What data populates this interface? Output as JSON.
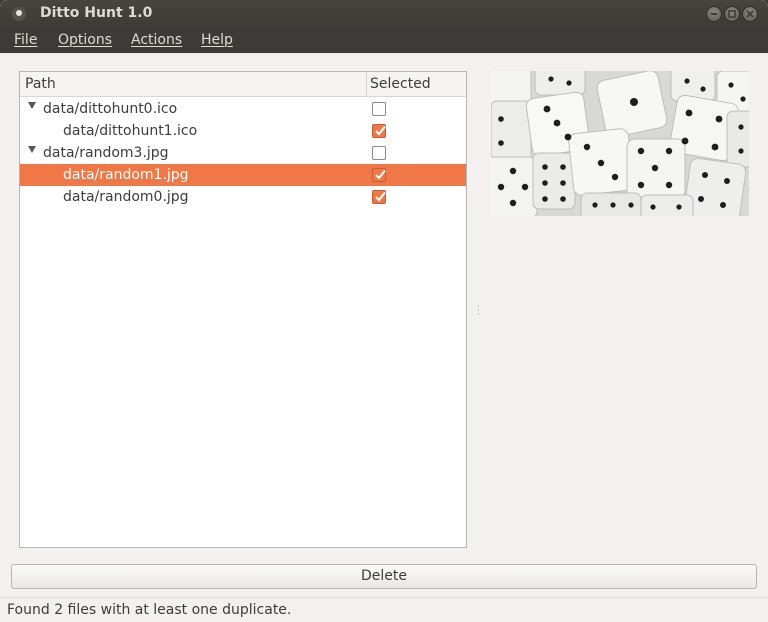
{
  "window": {
    "title": "Ditto Hunt 1.0"
  },
  "menubar": {
    "items": [
      "File",
      "Options",
      "Actions",
      "Help"
    ]
  },
  "tree": {
    "columns": {
      "path": "Path",
      "selected": "Selected"
    },
    "rows": [
      {
        "label": "data/dittohunt0.ico",
        "level": 0,
        "checked": false,
        "selected": false,
        "expanded": true
      },
      {
        "label": "data/dittohunt1.ico",
        "level": 1,
        "checked": true,
        "selected": false
      },
      {
        "label": "data/random3.jpg",
        "level": 0,
        "checked": false,
        "selected": false,
        "expanded": true
      },
      {
        "label": "data/random1.jpg",
        "level": 1,
        "checked": true,
        "selected": true
      },
      {
        "label": "data/random0.jpg",
        "level": 1,
        "checked": true,
        "selected": false
      }
    ]
  },
  "preview": {
    "icon": "dice-image"
  },
  "actions": {
    "delete_label": "Delete"
  },
  "status": {
    "text": "Found 2 files with at least one duplicate."
  },
  "colors": {
    "accent": "#f07746",
    "titlebar": "#3c3b37"
  }
}
